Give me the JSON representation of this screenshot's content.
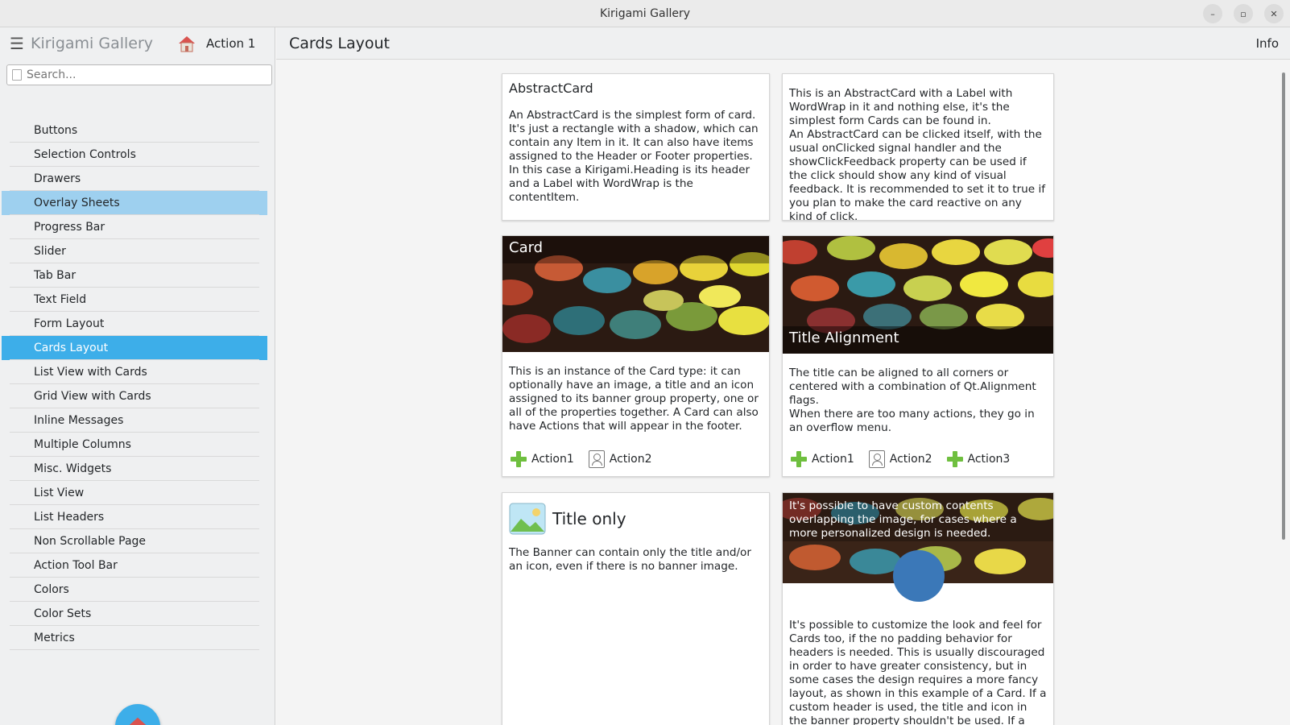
{
  "window": {
    "title": "Kirigami Gallery"
  },
  "sidebar": {
    "app_title": "Kirigami Gallery",
    "action_label": "Action 1",
    "search_placeholder": "Search...",
    "items": [
      {
        "label": "Buttons"
      },
      {
        "label": "Selection Controls"
      },
      {
        "label": "Drawers"
      },
      {
        "label": "Overlay Sheets"
      },
      {
        "label": "Progress Bar"
      },
      {
        "label": "Slider"
      },
      {
        "label": "Tab Bar"
      },
      {
        "label": "Text Field"
      },
      {
        "label": "Form Layout"
      },
      {
        "label": "Cards Layout"
      },
      {
        "label": "List View with Cards"
      },
      {
        "label": "Grid View with Cards"
      },
      {
        "label": "Inline Messages"
      },
      {
        "label": "Multiple Columns"
      },
      {
        "label": "Misc. Widgets"
      },
      {
        "label": "List View"
      },
      {
        "label": "List Headers"
      },
      {
        "label": "Non Scrollable Page"
      },
      {
        "label": "Action Tool Bar"
      },
      {
        "label": "Colors"
      },
      {
        "label": "Color Sets"
      },
      {
        "label": "Metrics"
      }
    ],
    "hovered_item": "Overlay Sheets",
    "selected_item": "Cards Layout"
  },
  "page": {
    "title": "Cards Layout",
    "info_label": "Info"
  },
  "cards": {
    "abstract": {
      "heading": "AbstractCard",
      "text": "An AbstractCard is the simplest form of card. It's just a rectangle with a shadow, which can contain any Item in it. It can also have items assigned to the Header or Footer properties. In this case a Kirigami.Heading is its header and a Label with WordWrap is the contentItem."
    },
    "abstract2": {
      "text": "This is an AbstractCard with a Label with WordWrap in it and nothing else, it's the simplest form Cards can be found in.\nAn AbstractCard can be clicked itself, with the usual onClicked signal handler and the showClickFeedback property can be used if the click should show any kind of visual feedback. It is recommended to set it to true if you plan to make the card reactive on any kind of click."
    },
    "card": {
      "banner_title": "Card",
      "text": "This is an instance of the Card type: it can optionally have an image, a title and an icon assigned to its banner group property, one or all of the properties together. A Card can also have Actions that will appear in the footer.",
      "actions": [
        "Action1",
        "Action2"
      ]
    },
    "alignment": {
      "banner_title": "Title Alignment",
      "text": "The title can be aligned to all corners or centered with a combination of Qt.Alignment flags.\n When there are too many actions, they go in an overflow menu.",
      "actions": [
        "Action1",
        "Action2",
        "Action3"
      ]
    },
    "title_only": {
      "title": "Title only",
      "text": "The Banner can contain only the title and/or an icon, even if there is no banner image."
    },
    "custom": {
      "overlay_text": "It's possible to have custom contents overlapping the image, for cases where a more personalized design is needed.",
      "text": "It's possible to customize the look and feel for Cards too, if the no padding behavior for headers is needed. This is usually discouraged in order to have greater consistency, but in some cases the design requires a more fancy layout, as shown in this example of a Card. If a custom header is used, the title and icon in the banner property shouldn't be used. If a custom"
    }
  },
  "colors": {
    "accent": "#3daee9",
    "hover": "#9ed0ef",
    "avatar_circle": "#3b78b8"
  }
}
